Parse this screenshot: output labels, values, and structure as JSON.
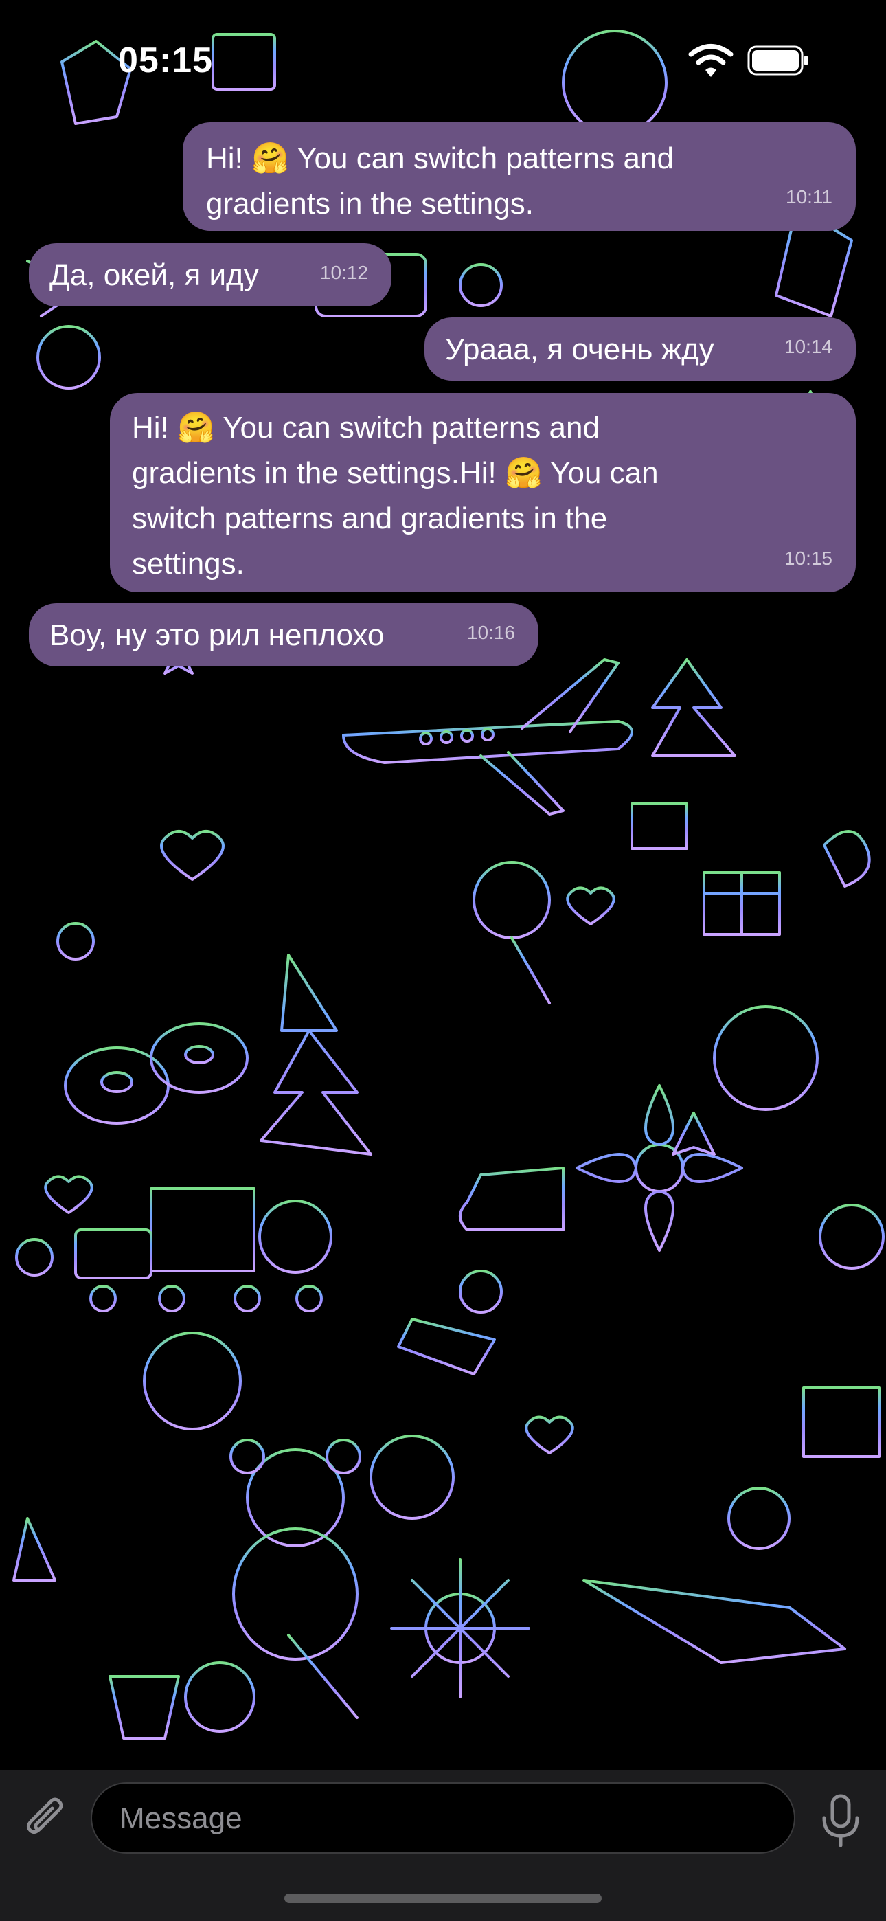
{
  "status_bar": {
    "time": "05:15"
  },
  "messages": [
    {
      "direction": "outgoing",
      "text": "Hi! 🤗 You can switch patterns and\ngradients in the settings.",
      "time": "10:11"
    },
    {
      "direction": "incoming",
      "text": "Да, окей, я иду",
      "time": "10:12"
    },
    {
      "direction": "outgoing",
      "text": "Урааа, я очень жду",
      "time": "10:14"
    },
    {
      "direction": "outgoing",
      "text": "Hi! 🤗 You can switch patterns and\ngradients in the settings.Hi! 🤗 You can\nswitch patterns and gradients in the\nsettings.",
      "time": "10:15"
    },
    {
      "direction": "incoming",
      "text": "Воу, ну это рил неплохо",
      "time": "10:16"
    }
  ],
  "input": {
    "placeholder": "Message"
  },
  "icons": {
    "attach": "paperclip-icon",
    "mic": "microphone-icon",
    "wifi": "wifi-icon",
    "battery": "battery-icon"
  },
  "colors": {
    "bubble": "#6a5282",
    "background": "#000000",
    "pattern_top": "#7be08a",
    "pattern_mid": "#7c8cff",
    "pattern_bottom": "#c9a3ff"
  }
}
